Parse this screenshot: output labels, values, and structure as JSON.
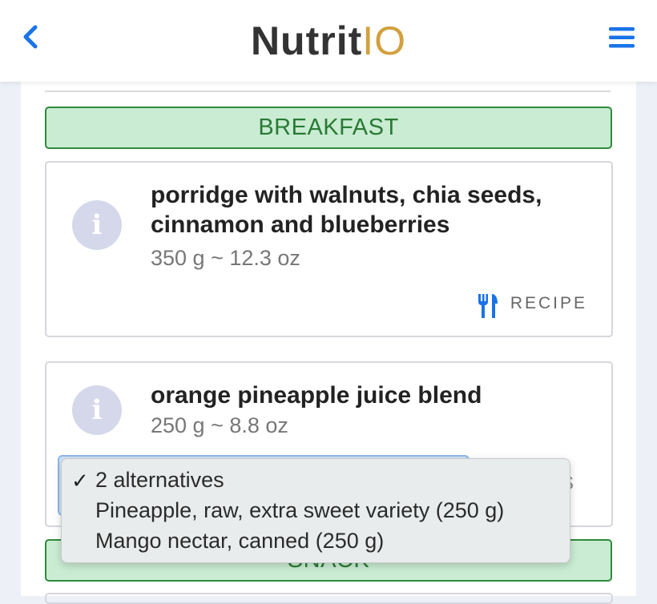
{
  "header": {
    "logo_part1": "Nutrit",
    "logo_part2": "IO"
  },
  "meals": [
    {
      "name": "BREAKFAST",
      "items": [
        {
          "title_line1": "porridge with walnuts, chia seeds,",
          "title_line2": "cinnamon and blueberries",
          "quantity": "350 g ~ 12.3 oz",
          "recipe_label": "RECIPE"
        },
        {
          "title_line1": "orange pineapple juice blend",
          "quantity": "250 g ~ 8.8 oz",
          "hidden_label_tail": "S"
        }
      ]
    },
    {
      "name": "SNACK"
    }
  ],
  "dropdown": {
    "selected_check": "✓",
    "options": [
      "2 alternatives",
      "Pineapple, raw, extra sweet variety (250 g)",
      "Mango nectar, canned (250 g)"
    ]
  },
  "colors": {
    "accent_blue": "#1a73e8",
    "logo_gold": "#d2a03c",
    "meal_green": "#2f8a3e"
  }
}
